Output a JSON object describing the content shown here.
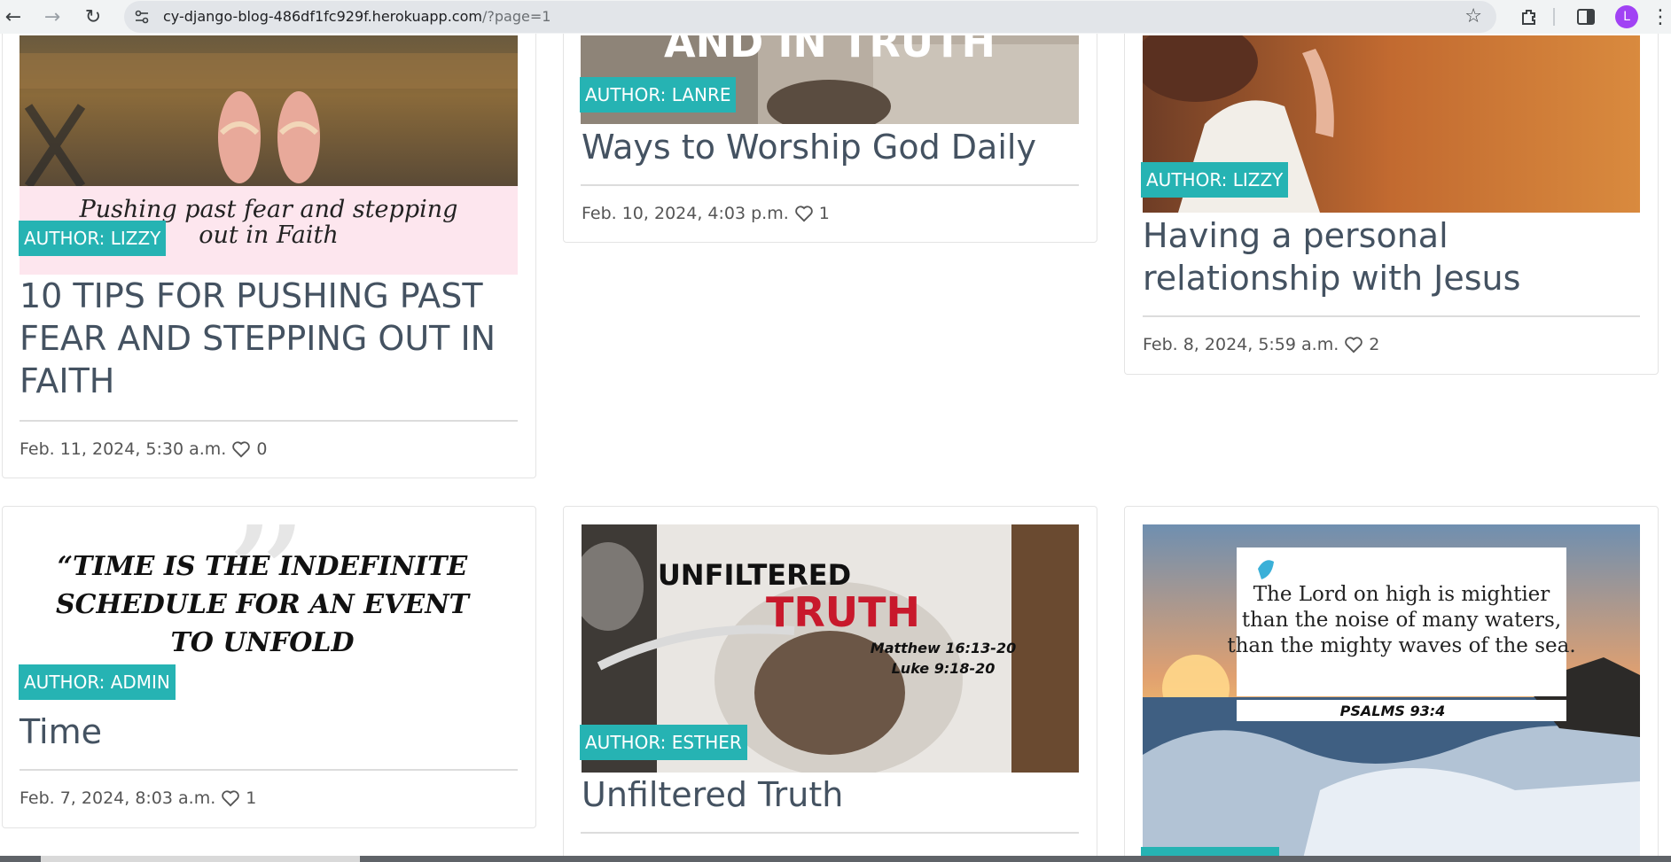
{
  "browser": {
    "url_host": "cy-django-blog-486df1fc929f.herokuapp.com",
    "url_path": "/?page=1",
    "profile_initial": "L",
    "icons": [
      "back-icon",
      "forward-icon",
      "reload-icon",
      "site-settings-icon",
      "bookmark-star-icon",
      "extensions-icon",
      "side-panel-icon",
      "profile-avatar",
      "more-menu-icon"
    ]
  },
  "posts": [
    {
      "author": "AUTHOR: LIZZY",
      "title": "10 TIPS FOR PUSHING PAST FEAR AND STEPPING OUT IN FAITH",
      "date": "Feb. 11, 2024, 5:30 a.m.",
      "likes": "0",
      "image_text": [
        "Pushing past fear and stepping",
        "out in Faith"
      ]
    },
    {
      "author": "AUTHOR: LANRE",
      "title": "Ways to Worship God Daily",
      "date": "Feb. 10, 2024, 4:03 p.m.",
      "likes": "1",
      "image_text": [
        "AND IN TRUTH"
      ]
    },
    {
      "author": "AUTHOR: LIZZY",
      "title": "Having a personal relationship with Jesus",
      "date": "Feb. 8, 2024, 5:59 a.m.",
      "likes": "2"
    },
    {
      "author": "AUTHOR: ADMIN",
      "title": "Time",
      "date": "Feb. 7, 2024, 8:03 a.m.",
      "likes": "1",
      "image_text": [
        "“TIME IS THE INDEFINITE",
        "SCHEDULE FOR AN EVENT",
        "TO UNFOLD"
      ]
    },
    {
      "author": "AUTHOR: ESTHER",
      "title": "Unfiltered Truth",
      "image_text": [
        "UNFILTERED",
        "TRUTH",
        "Matthew 16:13-20",
        "Luke 9:18-20"
      ]
    },
    {
      "image_text": [
        "The Lord on high is mightier",
        "than the noise of many waters,",
        "than the mighty waves of the sea.",
        "PSALMS 93:4"
      ]
    }
  ],
  "colors": {
    "badge": "#26b3b3",
    "title": "#445261",
    "chrome": "#f1f3f4",
    "avatar": "#a142f4"
  }
}
